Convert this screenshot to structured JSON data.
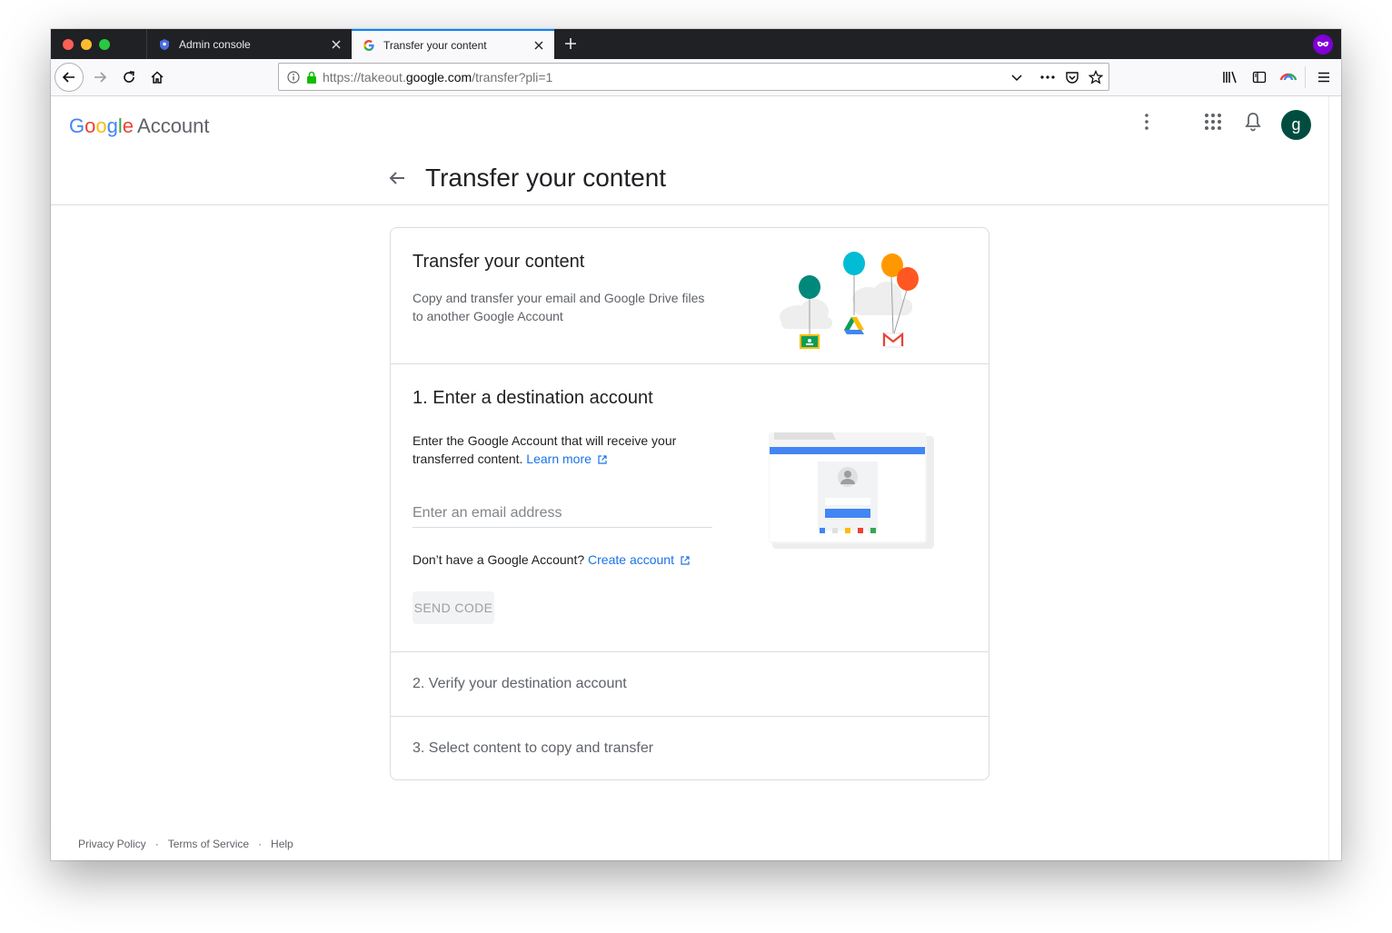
{
  "browser": {
    "tabs": [
      {
        "label": "Admin console",
        "active": false
      },
      {
        "label": "Transfer your content",
        "active": true
      }
    ],
    "url": {
      "prefix": "https://takeout.",
      "domain": "google.com",
      "path": "/transfer?pli=1"
    }
  },
  "header": {
    "logo_google": [
      "G",
      "o",
      "o",
      "g",
      "l",
      "e"
    ],
    "logo_account": "Account",
    "avatar_letter": "g"
  },
  "page": {
    "title": "Transfer your content"
  },
  "card": {
    "intro": {
      "title": "Transfer your content",
      "description": "Copy and transfer your email and Google Drive files to another Google Account"
    },
    "step1": {
      "title": "1. Enter a destination account",
      "description": "Enter the Google Account that will receive your transferred content.",
      "learn_more": "Learn more",
      "email_placeholder": "Enter an email address",
      "no_account_text": "Don’t have a Google Account?",
      "create_account": "Create account",
      "send_code": "SEND CODE"
    },
    "step2": {
      "title": "2. Verify your destination account"
    },
    "step3": {
      "title": "3. Select content to copy and transfer"
    }
  },
  "footer": {
    "privacy": "Privacy Policy",
    "terms": "Terms of Service",
    "help": "Help",
    "separator": "·"
  },
  "colors": {
    "google_blue": "#4285f4",
    "google_red": "#ea4335",
    "google_yellow": "#fbbc05",
    "google_green": "#34a853",
    "link": "#1a73e8",
    "avatar": "#004d40"
  }
}
